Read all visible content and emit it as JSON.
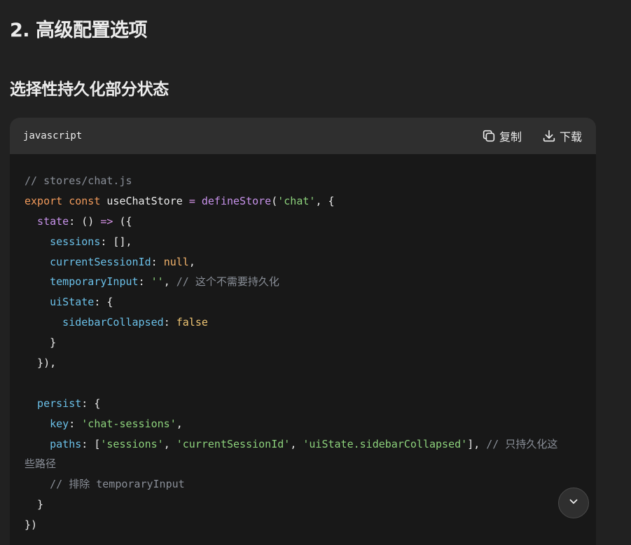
{
  "heading_main": "2. 高级配置选项",
  "heading_sub": "选择性持久化部分状态",
  "code_block": {
    "language": "javascript",
    "copy_label": "复制",
    "download_label": "下载",
    "lines": [
      [
        {
          "t": "// stores/chat.js",
          "c": "c-com"
        }
      ],
      [
        {
          "t": "export",
          "c": "c-kw"
        },
        {
          "t": " ",
          "c": "c-def"
        },
        {
          "t": "const",
          "c": "c-kw"
        },
        {
          "t": " useChatStore ",
          "c": "c-def"
        },
        {
          "t": "=",
          "c": "c-op"
        },
        {
          "t": " ",
          "c": "c-def"
        },
        {
          "t": "defineStore",
          "c": "c-fn"
        },
        {
          "t": "(",
          "c": "c-def"
        },
        {
          "t": "'chat'",
          "c": "c-str"
        },
        {
          "t": ", {",
          "c": "c-def"
        }
      ],
      [
        {
          "t": "  state",
          "c": "c-fn"
        },
        {
          "t": ": () ",
          "c": "c-def"
        },
        {
          "t": "=>",
          "c": "c-op"
        },
        {
          "t": " ({",
          "c": "c-def"
        }
      ],
      [
        {
          "t": "    sessions",
          "c": "c-prop"
        },
        {
          "t": ": [],",
          "c": "c-def"
        }
      ],
      [
        {
          "t": "    currentSessionId",
          "c": "c-prop"
        },
        {
          "t": ": ",
          "c": "c-def"
        },
        {
          "t": "null",
          "c": "c-num"
        },
        {
          "t": ",",
          "c": "c-def"
        }
      ],
      [
        {
          "t": "    temporaryInput",
          "c": "c-prop"
        },
        {
          "t": ": ",
          "c": "c-def"
        },
        {
          "t": "''",
          "c": "c-str"
        },
        {
          "t": ", ",
          "c": "c-def"
        },
        {
          "t": "// 这个不需要持久化",
          "c": "c-com"
        }
      ],
      [
        {
          "t": "    uiState",
          "c": "c-prop"
        },
        {
          "t": ": {",
          "c": "c-def"
        }
      ],
      [
        {
          "t": "      sidebarCollapsed",
          "c": "c-prop"
        },
        {
          "t": ": ",
          "c": "c-def"
        },
        {
          "t": "false",
          "c": "c-lit"
        }
      ],
      [
        {
          "t": "    }",
          "c": "c-def"
        }
      ],
      [
        {
          "t": "  }),",
          "c": "c-def"
        }
      ],
      [
        {
          "t": "",
          "c": "c-def"
        }
      ],
      [
        {
          "t": "  persist",
          "c": "c-prop"
        },
        {
          "t": ": {",
          "c": "c-def"
        }
      ],
      [
        {
          "t": "    key",
          "c": "c-prop"
        },
        {
          "t": ": ",
          "c": "c-def"
        },
        {
          "t": "'chat-sessions'",
          "c": "c-str"
        },
        {
          "t": ",",
          "c": "c-def"
        }
      ],
      [
        {
          "t": "    paths",
          "c": "c-prop"
        },
        {
          "t": ": [",
          "c": "c-def"
        },
        {
          "t": "'sessions'",
          "c": "c-str"
        },
        {
          "t": ", ",
          "c": "c-def"
        },
        {
          "t": "'currentSessionId'",
          "c": "c-str"
        },
        {
          "t": ", ",
          "c": "c-def"
        },
        {
          "t": "'uiState.sidebarCollapsed'",
          "c": "c-str"
        },
        {
          "t": "], ",
          "c": "c-def"
        },
        {
          "t": "// 只持久化这",
          "c": "c-com"
        }
      ],
      [
        {
          "t": "些路径",
          "c": "c-com"
        }
      ],
      [
        {
          "t": "    // 排除 temporaryInput",
          "c": "c-com"
        }
      ],
      [
        {
          "t": "  }",
          "c": "c-def"
        }
      ],
      [
        {
          "t": "})",
          "c": "c-def"
        }
      ]
    ]
  },
  "icons": {
    "copy": "copy-icon",
    "download": "download-icon",
    "scroll_down": "chevron-down-icon"
  },
  "colors": {
    "background": "#212121",
    "code_header": "#2f2f2f",
    "code_body": "#181818",
    "text": "#ececec",
    "comment": "#8a8f98",
    "keyword": "#f19a5b",
    "string": "#8dd27c",
    "property": "#6bc0e8"
  }
}
